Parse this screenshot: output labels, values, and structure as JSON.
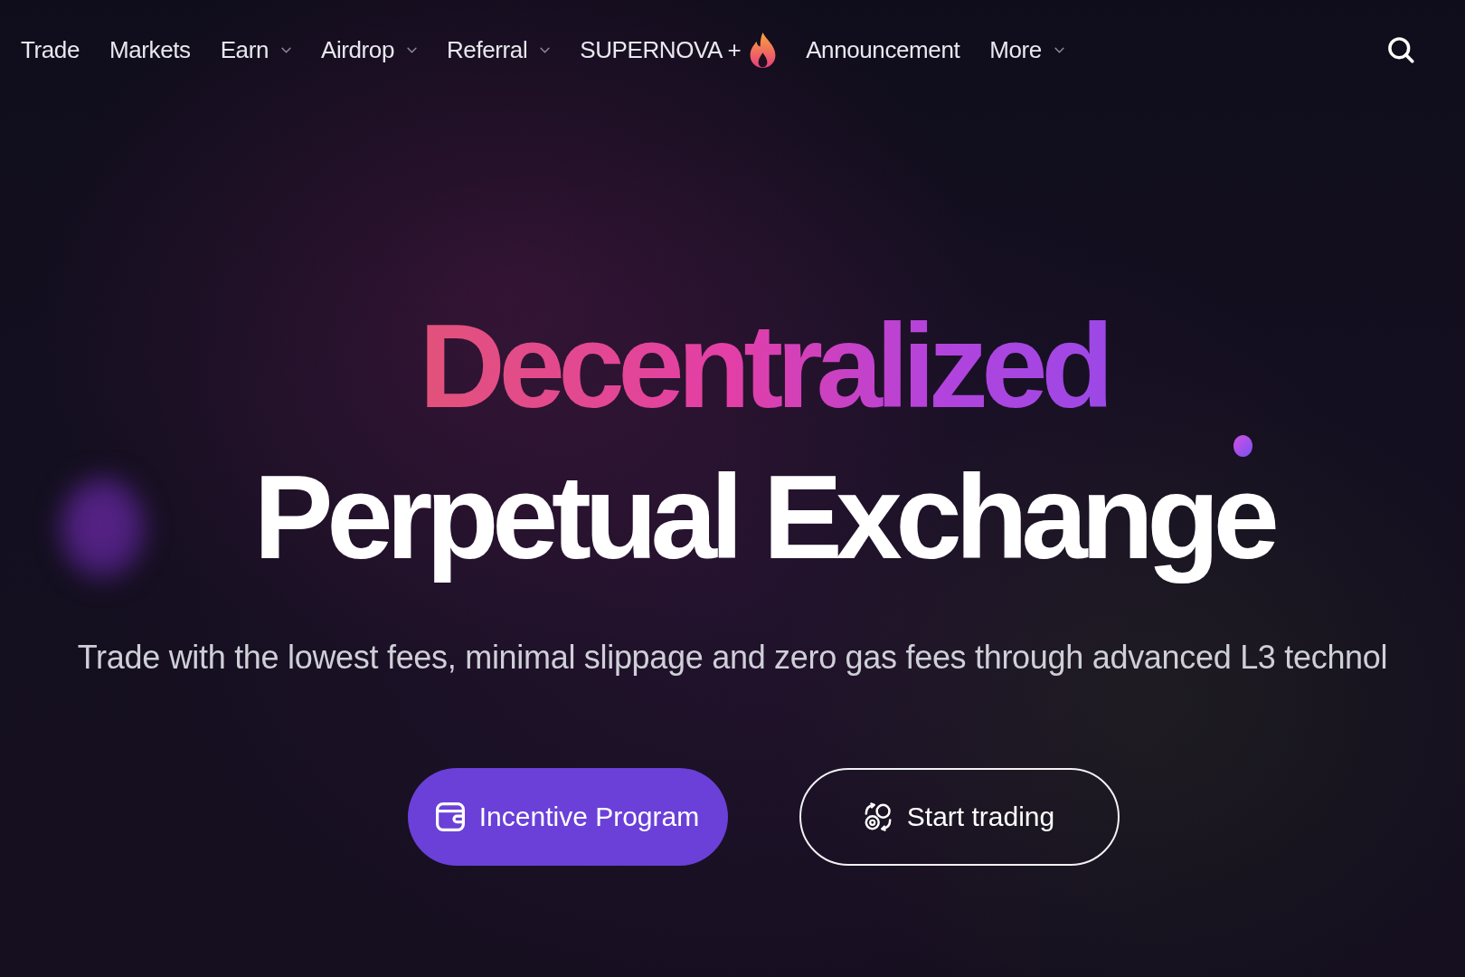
{
  "nav": {
    "items": [
      {
        "label": "Trade",
        "kind": "link"
      },
      {
        "label": "Markets",
        "kind": "link"
      },
      {
        "label": "Earn",
        "kind": "dropdown"
      },
      {
        "label": "Airdrop",
        "kind": "dropdown"
      },
      {
        "label": "Referral",
        "kind": "dropdown"
      },
      {
        "label": "SUPERNOVA +",
        "kind": "hot"
      },
      {
        "label": "Announcement",
        "kind": "link"
      },
      {
        "label": "More",
        "kind": "dropdown"
      }
    ]
  },
  "hero": {
    "title_highlight": "Decentralized",
    "title": "Perpetual Exchange",
    "subtitle": "Trade with the lowest fees, minimal slippage and zero gas fees through advanced L3 technol",
    "buttons": [
      {
        "label": "Incentive Program",
        "kind": "primary"
      },
      {
        "label": "Start trading",
        "kind": "outline"
      }
    ]
  }
}
